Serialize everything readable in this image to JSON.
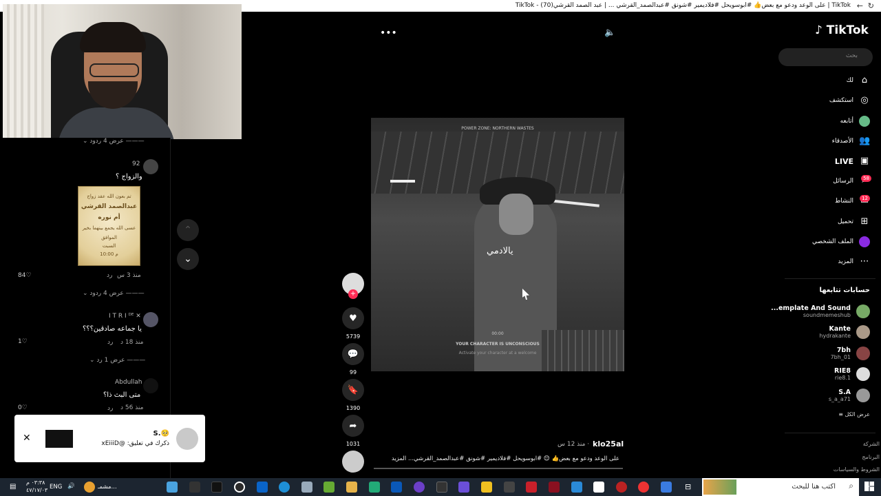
{
  "browser": {
    "tab_title": "TikTok | على الوعد ودعو مع بعض👍 #ابوسويحل #فلاديمير #شونق #عبدالصمد_القرشي ... | عبد الصمد القرشي(70) - TikTok"
  },
  "comments": [
    {
      "view_replies": "عرض 4 ردود"
    },
    {
      "user": "92",
      "text": "والزواج ؟",
      "time": "منذ 3 س",
      "reply": "رد",
      "likes": "84",
      "image_lines": [
        "تم بعون الله عقد زواج",
        "عبدالصمد القرشي",
        "أم نوره",
        "عسى الله يجمع بينهما بخير",
        "الموافق",
        "السبت",
        "10:00 م"
      ]
    },
    {
      "view_replies": "عرض 4 ردود"
    },
    {
      "user": "I T R I ᴰᴱ ✕",
      "text": "يا جماعه صادقين؟؟؟",
      "time": "منذ 18 د",
      "reply": "رد",
      "likes": "1"
    },
    {
      "view_replies": "عرض 1 رد"
    },
    {
      "user": "Abdullah",
      "text": "متى البث ذا؟",
      "time": "منذ 56 د",
      "reply": "رد",
      "likes": "0"
    }
  ],
  "video": {
    "subtitle": "يالادمي",
    "hud_top": "POWER ZONE: NORTHERN WASTES",
    "hud_timer": "00:00",
    "hud_msg": "YOUR CHARACTER IS UNCONSCIOUS",
    "hud_sub": "Activate your character at a welcome",
    "more_icon": "ellipsis-icon",
    "volume_icon": "volume-icon"
  },
  "actions": {
    "likes": "5739",
    "comments": "99",
    "saves": "1390",
    "shares": "1031"
  },
  "caption": {
    "user": "klo25al",
    "time": "· منذ 12 س",
    "text": "على الوعد ودعو مع بعض👍 😊 #ابوسويحل #فلاديمير #شونق #عبدالصمد_القرشي... المزيد"
  },
  "sidebar": {
    "logo": "TikTok",
    "search_placeholder": "بحث",
    "nav": [
      {
        "label": "لك",
        "icon": "home-icon"
      },
      {
        "label": "استكشف",
        "icon": "compass-icon"
      },
      {
        "label": "أتابعه",
        "icon": "following-avatar-icon"
      },
      {
        "label": "الأصدقاء",
        "icon": "friends-icon"
      },
      {
        "label": "LIVE",
        "icon": "live-icon"
      },
      {
        "label": "الرسائل",
        "icon": "messages-icon",
        "badge": "58"
      },
      {
        "label": "النشاط",
        "icon": "activity-icon",
        "badge": "12"
      },
      {
        "label": "تحميل",
        "icon": "upload-icon"
      },
      {
        "label": "الملف الشخصي",
        "icon": "profile-icon"
      },
      {
        "label": "المزيد",
        "icon": "more-icon"
      }
    ],
    "following_title": "حسابات تتابعها",
    "following": [
      {
        "name": "...emplate And Sound",
        "handle": "soundmemeshub"
      },
      {
        "name": "Kante",
        "handle": "hydrakante"
      },
      {
        "name": "7bh",
        "handle": "7bh_01"
      },
      {
        "name": "RIE8",
        "handle": "rie8.1"
      },
      {
        "name": "S.A",
        "handle": "s_a_a71"
      }
    ],
    "see_all": "عرض الكل",
    "footer": [
      "الشركة",
      "البرنامج",
      "الشروط والسياسات"
    ]
  },
  "toast": {
    "name": "S.🥺",
    "text": "ذكرك في تعليق: @xEiiiD"
  },
  "taskbar": {
    "search_placeholder": "اكتب هنا للبحث",
    "app_label": "مشمـ...",
    "lang": "ENG",
    "time": "٠٣:٣٨ م",
    "date": "٤٧/١٧/٠٣"
  },
  "colors": {
    "accent": "#fe2c55",
    "background": "#000000",
    "taskbar": "#1c2530"
  }
}
